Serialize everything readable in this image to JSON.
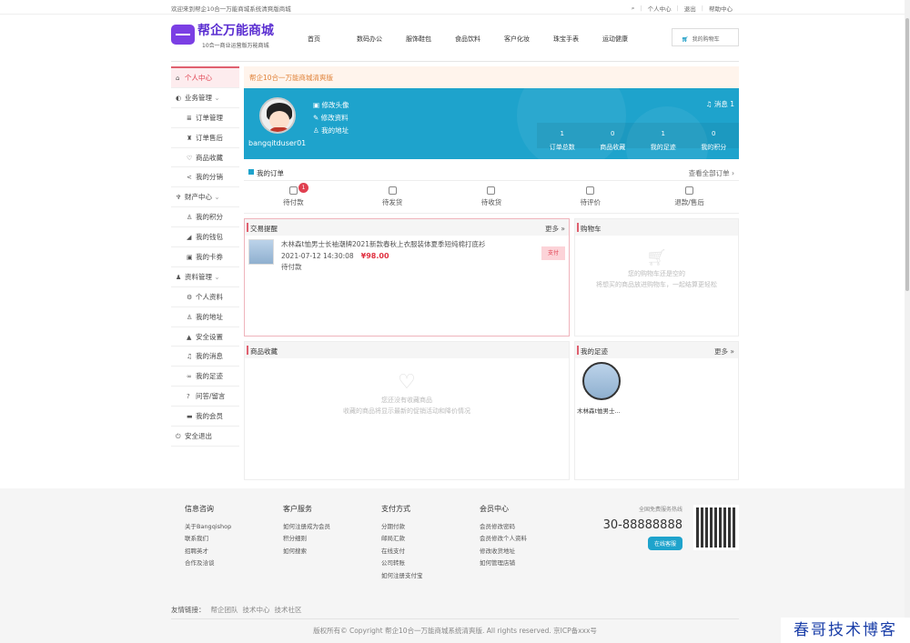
{
  "topbar": {
    "welcome": "欢迎来到帮企10合一万能商城系统清爽版商城",
    "links": [
      "个人中心",
      "退出",
      "帮助中心"
    ]
  },
  "header": {
    "logo_title": "帮企万能商城",
    "logo_sub": "10合一商业运营版万能商城",
    "nav": [
      "首页",
      "数码办公",
      "服饰鞋包",
      "食品饮料",
      "客户化妆",
      "珠宝手表",
      "运动健康"
    ],
    "cart": "我的购物车"
  },
  "sidebar": [
    {
      "label": "个人中心",
      "icon": "home-icon",
      "g": "⌂",
      "type": "act"
    },
    {
      "label": "业务管理",
      "icon": "cube-icon",
      "g": "◐",
      "type": "group"
    },
    {
      "label": "订单管理",
      "icon": "list-icon",
      "g": "≣",
      "type": "sub"
    },
    {
      "label": "订单售后",
      "icon": "service-icon",
      "g": "♜",
      "type": "sub"
    },
    {
      "label": "商品收藏",
      "icon": "heart-icon",
      "g": "♡",
      "type": "sub"
    },
    {
      "label": "我的分销",
      "icon": "share-icon",
      "g": "<",
      "type": "sub"
    },
    {
      "label": "财产中心",
      "icon": "trophy-icon",
      "g": "♆",
      "type": "group"
    },
    {
      "label": "我的积分",
      "icon": "points-icon",
      "g": "♙",
      "type": "sub"
    },
    {
      "label": "我的钱包",
      "icon": "wallet-icon",
      "g": "◢",
      "type": "sub"
    },
    {
      "label": "我的卡券",
      "icon": "gift-icon",
      "g": "▣",
      "type": "sub"
    },
    {
      "label": "资料管理",
      "icon": "user-icon",
      "g": "♟",
      "type": "group"
    },
    {
      "label": "个人资料",
      "icon": "gear-icon",
      "g": "⚙",
      "type": "sub"
    },
    {
      "label": "我的地址",
      "icon": "location-icon",
      "g": "♙",
      "type": "sub"
    },
    {
      "label": "安全设置",
      "icon": "lock-icon",
      "g": "▲",
      "type": "sub"
    },
    {
      "label": "我的消息",
      "icon": "bell-icon",
      "g": "♫",
      "type": "sub"
    },
    {
      "label": "我的足迹",
      "icon": "footprint-icon",
      "g": "∞",
      "type": "sub"
    },
    {
      "label": "问答/留言",
      "icon": "question-icon",
      "g": "?",
      "type": "sub"
    },
    {
      "label": "我的会员",
      "icon": "vip-icon",
      "g": "▬",
      "type": "sub"
    },
    {
      "label": "安全退出",
      "icon": "power-icon",
      "g": "⏻",
      "type": "item"
    }
  ],
  "notice": "帮企10合一万能商城清爽版",
  "profile": {
    "username": "bangqitduser01",
    "links": [
      "修改头像",
      "修改资料",
      "我的地址"
    ],
    "message": "消息 1",
    "stats": [
      {
        "value": "1",
        "label": "订单总数"
      },
      {
        "value": "0",
        "label": "商品收藏"
      },
      {
        "value": "1",
        "label": "我的足迹"
      },
      {
        "value": "0",
        "label": "我的积分"
      }
    ]
  },
  "orders": {
    "title": "我的订单",
    "view_all": "查看全部订单",
    "statuses": [
      {
        "label": "待付款",
        "badge": "1"
      },
      {
        "label": "待发货"
      },
      {
        "label": "待收货"
      },
      {
        "label": "待评价"
      },
      {
        "label": "退款/售后"
      }
    ]
  },
  "trade": {
    "title": "交易提醒",
    "more": "更多 »",
    "item": {
      "name": "木林森t恤男士长袖潮牌2021新款春秋上衣服装体夏季短纯棉打底衫",
      "time": "2021-07-12 14:30:08",
      "price": "¥98.00",
      "status": "待付款",
      "pay": "支付"
    }
  },
  "cart": {
    "title": "购物车",
    "empty1": "您的购物车还是空的",
    "empty2": "将想买的商品放进购物车，一起结算更轻松"
  },
  "favorites": {
    "title": "商品收藏",
    "empty1": "您还没有收藏商品",
    "empty2": "收藏的商品将显示最新的促销活动和降价情况"
  },
  "footprints": {
    "title": "我的足迹",
    "more": "更多 »",
    "item": "木林森t恤男士..."
  },
  "footer": {
    "cols": [
      {
        "title": "信息咨询",
        "items": [
          "关于Bangqishop",
          "联系我们",
          "招聘英才",
          "合作及洽谈"
        ]
      },
      {
        "title": "客户服务",
        "items": [
          "如何注册成为会员",
          "积分细则",
          "如何搜索"
        ]
      },
      {
        "title": "支付方式",
        "items": [
          "分期付款",
          "邮局汇款",
          "在线支付",
          "公司转账",
          "如何注册支付宝"
        ]
      },
      {
        "title": "会员中心",
        "items": [
          "会员修改密码",
          "会员修改个人资料",
          "修改收货地址",
          "如何管理店铺"
        ]
      }
    ],
    "hotline_label": "全国免费服务热线",
    "hotline": "30-88888888",
    "online": "在线客服",
    "links_label": "友情链接：",
    "links": [
      "帮企团队",
      "技术中心",
      "技术社区"
    ],
    "copyright": "版权所有© Copyright 帮企10合一万能商城系统清爽版. All rights reserved. 京ICP备xxx号"
  },
  "watermark": "春哥技术博客",
  "colors": {
    "accent": "#1ea3cc",
    "brand": "#5b2fd1",
    "highlight": "#e0606f"
  }
}
